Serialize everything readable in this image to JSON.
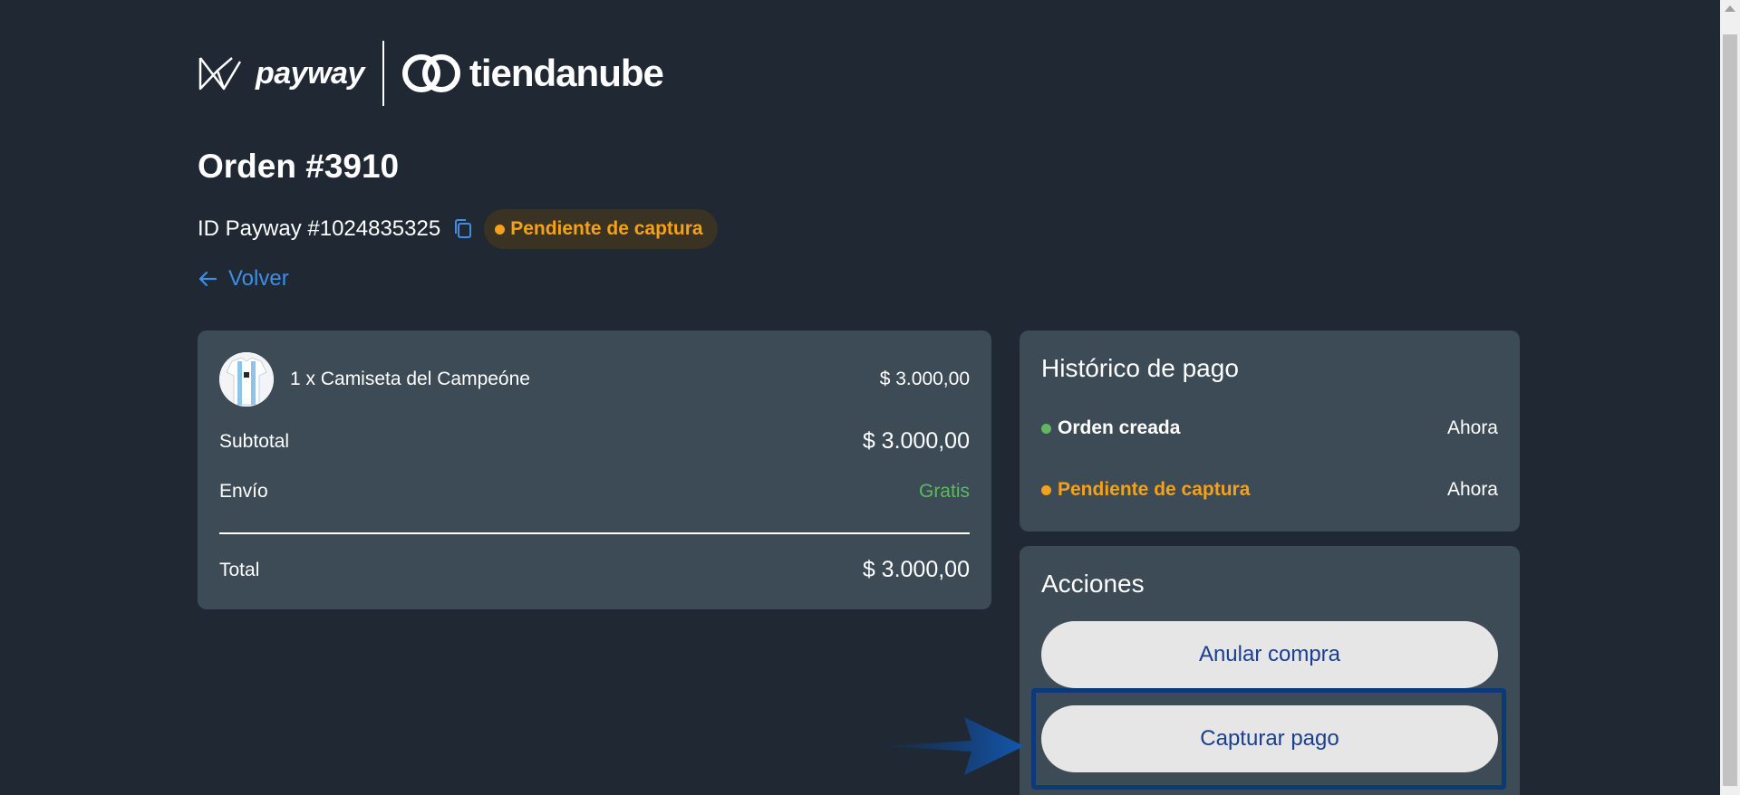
{
  "header": {
    "payway_logo_text": "payway",
    "tiendanube_logo_text": "tiendanube"
  },
  "order": {
    "title": "Orden #3910",
    "payway_id": "ID Payway #1024835325",
    "status_badge": "Pendiente de captura",
    "back_label": "Volver"
  },
  "summary": {
    "item": {
      "name": "1 x Camiseta del Campeóne",
      "price": "$ 3.000,00"
    },
    "subtotal_label": "Subtotal",
    "subtotal_value": "$ 3.000,00",
    "shipping_label": "Envío",
    "shipping_value": "Gratis",
    "total_label": "Total",
    "total_value": "$ 3.000,00"
  },
  "history": {
    "title": "Histórico de pago",
    "events": [
      {
        "label": "Orden creada",
        "time": "Ahora",
        "color": "#5fb85f"
      },
      {
        "label": "Pendiente de captura",
        "time": "Ahora",
        "color": "#f5a11a"
      }
    ]
  },
  "actions": {
    "title": "Acciones",
    "cancel_label": "Anular compra",
    "capture_label": "Capturar pago"
  },
  "colors": {
    "background": "#1f2833",
    "card": "#3d4b57",
    "accent_link": "#3d8fe6",
    "pending": "#f5a11a",
    "success": "#5fb85f",
    "button_text": "#1a3f8f"
  }
}
